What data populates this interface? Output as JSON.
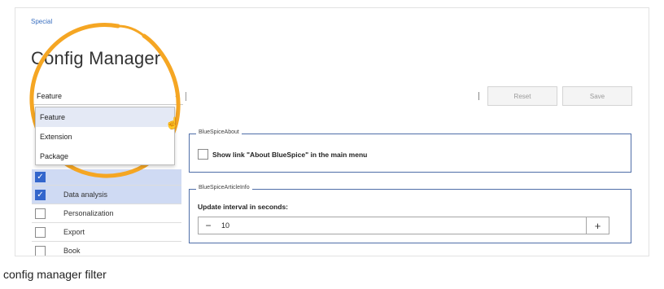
{
  "breadcrumb": "Special",
  "page_title": "Config Manager",
  "filter": {
    "selected": "Feature",
    "options": [
      "Feature",
      "Extension",
      "Package"
    ]
  },
  "toolbar": {
    "reset_label": "Reset",
    "save_label": "Save"
  },
  "feature_list": [
    {
      "label": "",
      "checked": true,
      "selected": true
    },
    {
      "label": "Data analysis",
      "checked": true,
      "selected": true
    },
    {
      "label": "Personalization",
      "checked": false,
      "selected": false
    },
    {
      "label": "Export",
      "checked": false,
      "selected": false
    },
    {
      "label": "Book",
      "checked": false,
      "selected": false
    }
  ],
  "sections": {
    "about": {
      "legend": "BlueSpiceAbout",
      "option_label": "Show link \"About BlueSpice\" in the main menu"
    },
    "article_info": {
      "legend": "BlueSpiceArticleInfo",
      "field_label": "Update interval in seconds:",
      "value": "10",
      "minus": "−",
      "plus": "+"
    }
  },
  "caption": "config manager filter",
  "colors": {
    "accent": "#3366cc",
    "highlight": "#f5a623"
  }
}
